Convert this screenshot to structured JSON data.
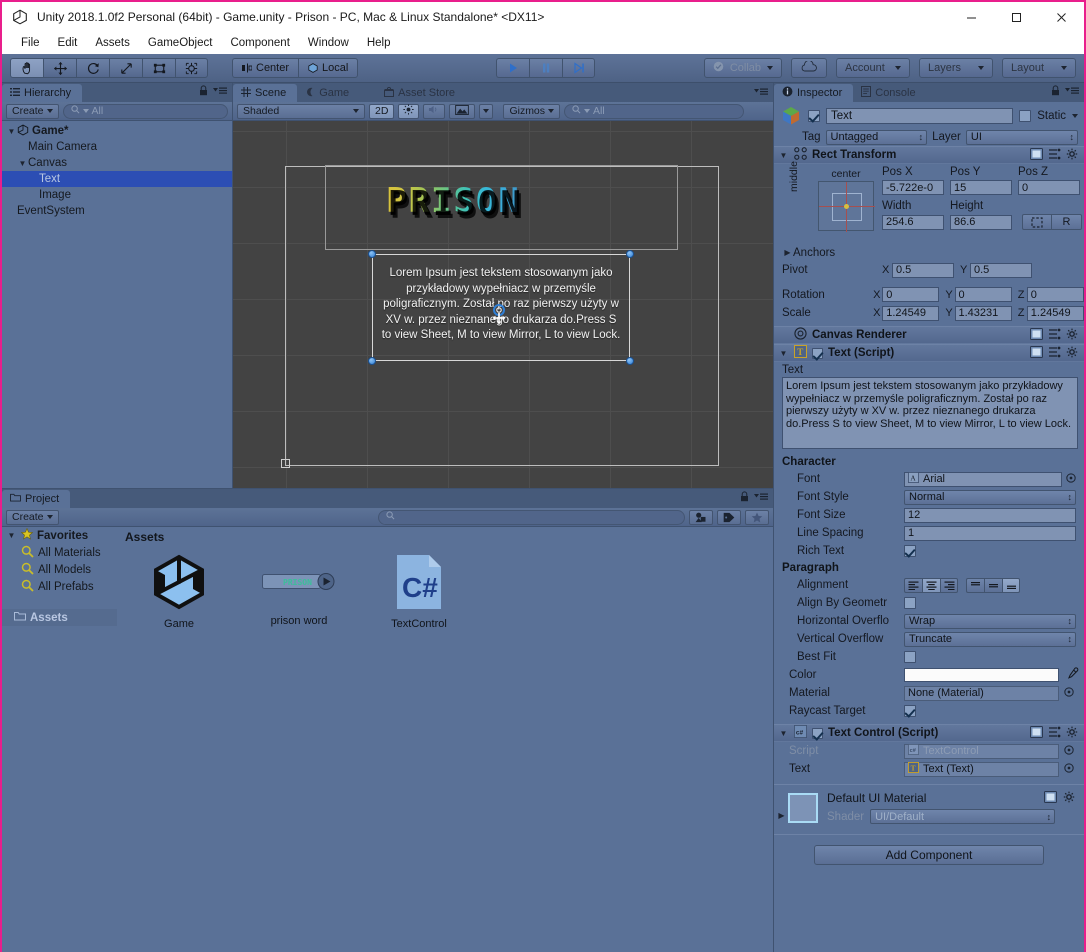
{
  "window": {
    "title": "Unity 2018.1.0f2 Personal (64bit) - Game.unity - Prison - PC, Mac & Linux Standalone* <DX11>",
    "minimize": "—",
    "maximize": "☐",
    "close": "✕"
  },
  "menubar": {
    "items": [
      "File",
      "Edit",
      "Assets",
      "GameObject",
      "Component",
      "Window",
      "Help"
    ]
  },
  "toolbar": {
    "tools": [
      "hand-tool",
      "move-tool",
      "rotate-tool",
      "scale-tool",
      "rect-tool",
      "transform-tool"
    ],
    "pivot_mode": "Center",
    "pivot_rotation": "Local",
    "play": "play-icon",
    "pause": "pause-icon",
    "step": "step-icon",
    "collab": "Collab",
    "cloud": "cloud-icon",
    "account": "Account",
    "layers": "Layers",
    "layout": "Layout"
  },
  "hierarchy": {
    "tab": "Hierarchy",
    "create": "Create",
    "search_placeholder": "All",
    "items": [
      {
        "label": "Game*",
        "depth": 0,
        "selected": false,
        "expanded": true,
        "root": true
      },
      {
        "label": "Main Camera",
        "depth": 1,
        "selected": false,
        "expanded": false
      },
      {
        "label": "Canvas",
        "depth": 1,
        "selected": false,
        "expanded": true
      },
      {
        "label": "Text",
        "depth": 2,
        "selected": true,
        "expanded": false
      },
      {
        "label": "Image",
        "depth": 2,
        "selected": false,
        "expanded": false
      },
      {
        "label": "EventSystem",
        "depth": 1,
        "selected": false,
        "expanded": false
      }
    ]
  },
  "scene": {
    "tabs": [
      {
        "label": "Scene",
        "active": true
      },
      {
        "label": "Game",
        "active": false
      },
      {
        "label": "Asset Store",
        "active": false
      }
    ],
    "draw_mode": "Shaded",
    "two_d": "2D",
    "lighting": "light-icon",
    "audio": "audio-icon",
    "fx": "fx-icon",
    "gizmos": "Gizmos",
    "search_placeholder": "All",
    "title_art": "PRISON",
    "body_text": "Lorem Ipsum jest tekstem stosowanym jako przykładowy wypełniacz w przemyśle poligraficznym. Został po raz  pierwszy użyty w XV w. przez nieznanego drukarza do.Press S to view Sheet, M to view Mirror, L to view Lock.",
    "body_lines": [
      "Lorem Ipsum jest tekstem stosowanym jako",
      "przykładowy wypełniacz w przemyśle",
      "poligraficznym. Został po raz  pierwszy użyty w",
      "XV w. przez nieznanego drukarza do.Press S",
      "to view Sheet, M to view Mirror, L to view Lock."
    ]
  },
  "project": {
    "tab": "Project",
    "create": "Create",
    "search_placeholder": "",
    "favorites_label": "Favorites",
    "favorites": [
      "All Materials",
      "All Models",
      "All Prefabs"
    ],
    "assets_tree_label": "Assets",
    "breadcrumb": "Assets",
    "assets": [
      {
        "label": "Game",
        "icon": "unity-scene-icon"
      },
      {
        "label": "prison word",
        "icon": "texture-asset-icon"
      },
      {
        "label": "TextControl",
        "icon": "csharp-script-icon"
      }
    ]
  },
  "inspector": {
    "tabs": [
      {
        "label": "Inspector",
        "active": true
      },
      {
        "label": "Console",
        "active": false
      }
    ],
    "object_name": "Text",
    "object_enabled": true,
    "static_label": "Static",
    "static_checked": false,
    "tag_label": "Tag",
    "tag_value": "Untagged",
    "layer_label": "Layer",
    "layer_value": "UI",
    "rect_transform": {
      "title": "Rect Transform",
      "anchor_preset": "center",
      "anchor_preset_v": "middle",
      "pos_x_label": "Pos X",
      "pos_x": "-5.722e-0",
      "pos_y_label": "Pos Y",
      "pos_y": "15",
      "pos_z_label": "Pos Z",
      "pos_z": "0",
      "width_label": "Width",
      "width": "254.6",
      "height_label": "Height",
      "height": "86.6",
      "blueprint_btn": "blueprint-icon",
      "raw_btn": "R",
      "anchors_label": "Anchors",
      "pivot_label": "Pivot",
      "pivot_x": "0.5",
      "pivot_y": "0.5",
      "rotation_label": "Rotation",
      "rot_x": "0",
      "rot_y": "0",
      "rot_z": "0",
      "scale_label": "Scale",
      "scale_x": "1.24549",
      "scale_y": "1.43231",
      "scale_z": "1.24549"
    },
    "canvas_renderer": {
      "title": "Canvas Renderer"
    },
    "text_script": {
      "title": "Text (Script)",
      "enabled": true,
      "text_label": "Text",
      "text_value": "Lorem Ipsum jest tekstem stosowanym jako przykładowy wypełniacz w przemyśle poligraficznym. Został po raz  pierwszy użyty w XV w. przez nieznanego drukarza do.Press S to view Sheet, M to view Mirror, L to view Lock.",
      "character_label": "Character",
      "font_label": "Font",
      "font_value": "Arial",
      "font_style_label": "Font Style",
      "font_style_value": "Normal",
      "font_size_label": "Font Size",
      "font_size_value": "12",
      "line_spacing_label": "Line Spacing",
      "line_spacing_value": "1",
      "rich_text_label": "Rich Text",
      "rich_text_checked": true,
      "paragraph_label": "Paragraph",
      "alignment_label": "Alignment",
      "align_h_selected": 1,
      "align_v_selected": 2,
      "align_by_geometry_label": "Align By Geometr",
      "align_by_geometry_checked": false,
      "h_overflow_label": "Horizontal Overflo",
      "h_overflow_value": "Wrap",
      "v_overflow_label": "Vertical Overflow",
      "v_overflow_value": "Truncate",
      "best_fit_label": "Best Fit",
      "best_fit_checked": false,
      "color_label": "Color",
      "color_value": "#FFFFFF",
      "material_label": "Material",
      "material_value": "None (Material)",
      "raycast_label": "Raycast Target",
      "raycast_checked": true
    },
    "text_control": {
      "title": "Text Control (Script)",
      "enabled": true,
      "script_label": "Script",
      "script_value": "TextControl",
      "text_label": "Text",
      "text_value": "Text (Text)"
    },
    "material": {
      "title": "Default UI Material",
      "shader_label": "Shader",
      "shader_value": "UI/Default"
    },
    "add_component": "Add Component"
  },
  "colors": {
    "panel": "#5a7197",
    "tabbar": "#465a7a",
    "selection": "#2c4eb4",
    "scene_bg": "#434343",
    "accent_pink": "#e91e8c"
  }
}
